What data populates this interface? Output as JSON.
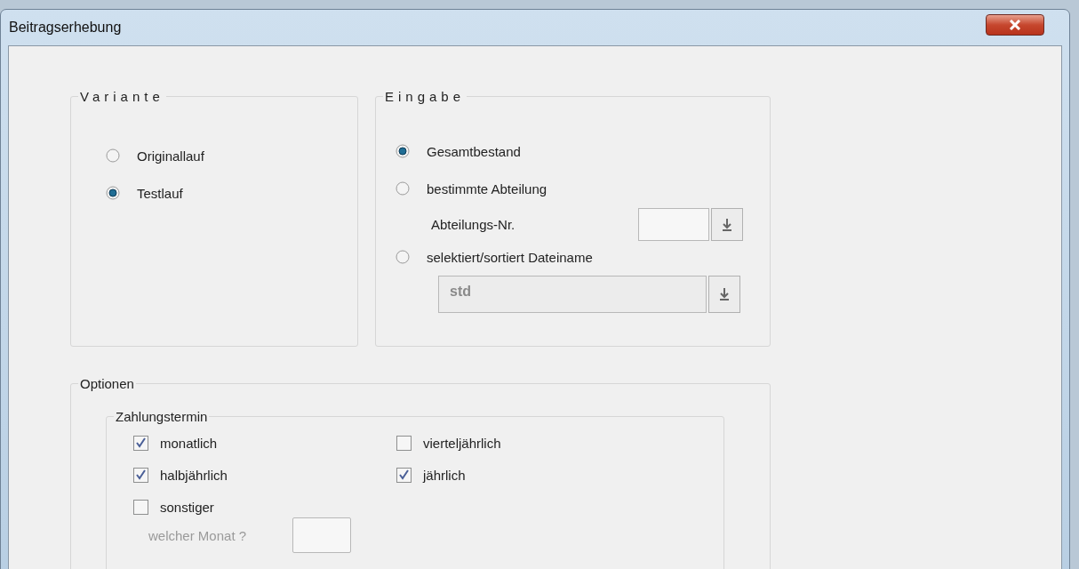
{
  "window": {
    "title": "Beitragserhebung"
  },
  "variante": {
    "legend": "Variante",
    "options": [
      {
        "label": "Originallauf",
        "selected": false
      },
      {
        "label": "Testlauf",
        "selected": true
      }
    ]
  },
  "eingabe": {
    "legend": "Eingabe",
    "options": [
      {
        "label": "Gesamtbestand",
        "selected": true
      },
      {
        "label": "bestimmte Abteilung",
        "selected": false
      },
      {
        "label": "selektiert/sortiert Dateiname",
        "selected": false
      }
    ],
    "abteilung": {
      "label": "Abteilungs-Nr."
    },
    "dateiname": {
      "value": "std",
      "disabled": true
    }
  },
  "optionen": {
    "legend": "Optionen",
    "zahlungstermin": {
      "legend": "Zahlungstermin",
      "options": [
        {
          "label": "monatlich",
          "checked": true
        },
        {
          "label": "vierteljährlich",
          "checked": false
        },
        {
          "label": "halbjährlich",
          "checked": true
        },
        {
          "label": "jährlich",
          "checked": true
        },
        {
          "label": "sonstiger",
          "checked": false
        }
      ],
      "monat": {
        "label": "welcher Monat ?",
        "disabled": true
      }
    }
  }
}
